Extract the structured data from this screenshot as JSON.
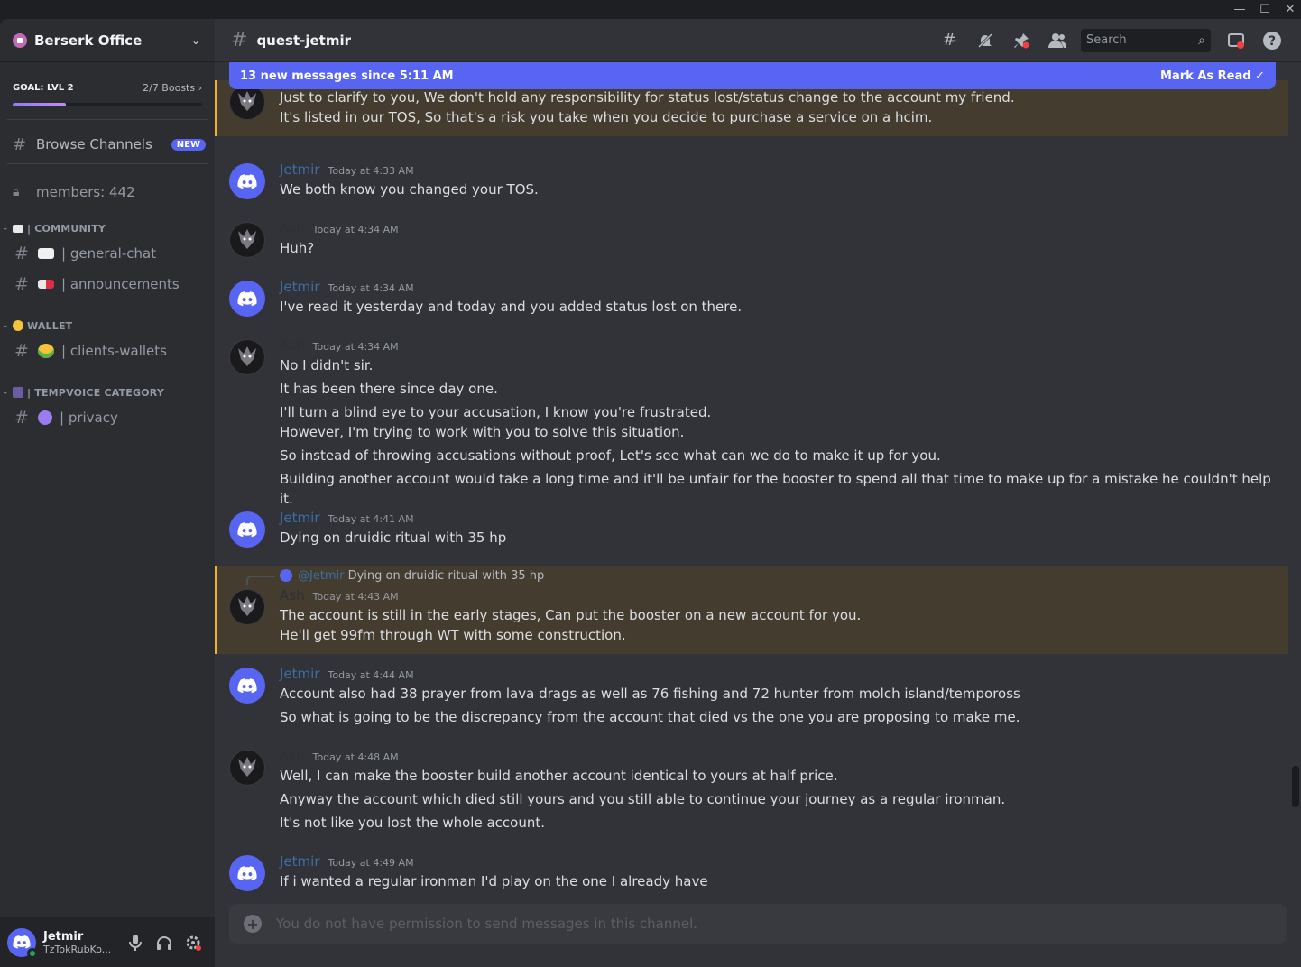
{
  "window": {
    "minimize": "—",
    "maximize": "☐",
    "close": "✕"
  },
  "server": {
    "name": "Berserk Office"
  },
  "goal": {
    "title": "GOAL: LVL 2",
    "boosts": "2/7 Boosts",
    "progress": 0.28
  },
  "sidebar": {
    "browse": {
      "label": "Browse Channels",
      "badge": "NEW"
    },
    "members": "members: 442",
    "categories": [
      {
        "label": "| COMMUNITY",
        "channels": [
          {
            "label": "| general-chat"
          },
          {
            "label": "| announcements"
          }
        ]
      },
      {
        "label": "WALLET",
        "channels": [
          {
            "label": "| clients-wallets"
          }
        ]
      },
      {
        "label": "| TEMPVOICE CATEGORY",
        "channels": [
          {
            "label": "| privacy"
          }
        ]
      }
    ]
  },
  "user": {
    "name": "Jetmir",
    "tag": "TzTokRubKo..."
  },
  "channel": {
    "name": "quest-jetmir",
    "search_placeholder": "Search"
  },
  "new_messages": {
    "text": "13 new messages since 5:11 AM",
    "action": "Mark As Read"
  },
  "messages": [
    {
      "author": "Ash",
      "time": "",
      "highlight": true,
      "lines": [
        "Just to clarify to you, We don't hold any responsibility for status lost/status change to the account my friend.",
        "It's listed in our TOS, So that's a risk you take when you decide to purchase a service on a hcim."
      ]
    },
    {
      "author": "Jetmir",
      "time": "Today at 4:33 AM",
      "lines": [
        "We both know you changed your TOS."
      ]
    },
    {
      "author": "Ash",
      "time": "Today at 4:34 AM",
      "lines": [
        "Huh?"
      ]
    },
    {
      "author": "Jetmir",
      "time": "Today at 4:34 AM",
      "lines": [
        "I've read it yesterday and today and you added status lost on there."
      ]
    },
    {
      "author": "Ash",
      "time": "Today at 4:34 AM",
      "lines": [
        "No I didn't sir.",
        "It has been there since day one.",
        "I'll turn a blind eye to your accusation, I know you're frustrated.",
        "However, I'm trying to work with you to solve this situation.",
        "So instead of throwing accusations without proof, Let's see what can we do to make it up for you.",
        "Building another account would take a long time and it'll be unfair for the booster to spend all that time to make up for a mistake he couldn't help it."
      ]
    },
    {
      "author": "Jetmir",
      "time": "Today at 4:41 AM",
      "lines": [
        "Dying on druidic ritual with 35 hp"
      ]
    },
    {
      "author": "Ash",
      "time": "Today at 4:43 AM",
      "highlight": true,
      "reply": {
        "name": "@Jetmir",
        "text": "Dying on druidic ritual with 35 hp"
      },
      "lines": [
        "The account is still in the early stages, Can put the booster on a new account for you.",
        "He'll get 99fm through WT with some construction."
      ]
    },
    {
      "author": "Jetmir",
      "time": "Today at 4:44 AM",
      "lines": [
        "Account also had 38 prayer from lava drags as well as 76 fishing and 72 hunter from molch island/tempoross",
        "So what is going to be the discrepancy from the account that died vs the one you are proposing to make me."
      ]
    },
    {
      "author": "Ash",
      "time": "Today at 4:48 AM",
      "lines": [
        "Well, I can make the booster build another account identical to yours at half price.",
        "Anyway the account which died still yours and you still able to continue your journey as a regular ironman.",
        "It's not like you lost the whole account."
      ]
    },
    {
      "author": "Jetmir",
      "time": "Today at 4:49 AM",
      "lines": [
        "If i wanted a regular ironman I'd play on the one I already have"
      ]
    }
  ],
  "composer": {
    "placeholder": "You do not have permission to send messages in this channel."
  },
  "colors": {
    "accent": "#5865f2",
    "highlight_bg": "#433c2f",
    "highlight_border": "#f0b232",
    "online": "#23a55a"
  }
}
